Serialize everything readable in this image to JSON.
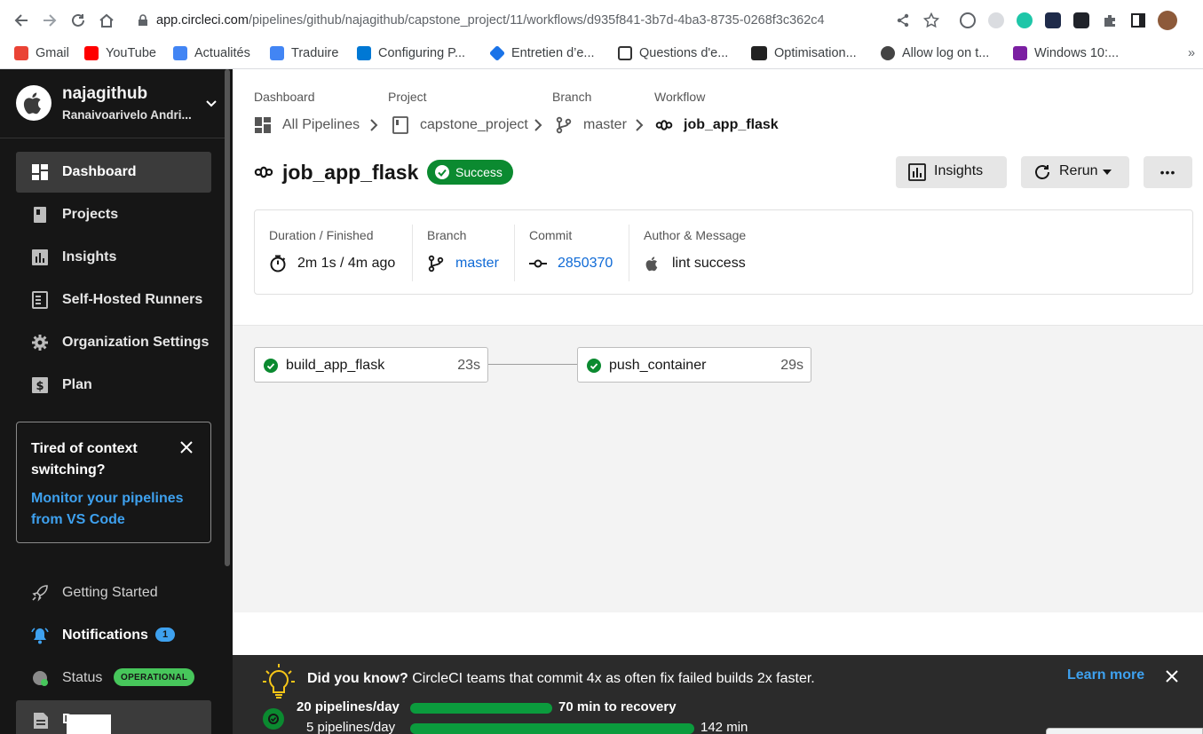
{
  "browser": {
    "url_host": "app.circleci.com",
    "url_path": "/pipelines/github/najagithub/capstone_project/11/workflows/d935f841-3b7d-4ba3-8735-0268f3c362c4",
    "bookmarks": [
      {
        "label": "Gmail",
        "icon": "gmail-icon",
        "color": "#ea4335"
      },
      {
        "label": "YouTube",
        "icon": "youtube-icon",
        "color": "#ff0000"
      },
      {
        "label": "Actualités",
        "icon": "news-icon",
        "color": "#4285f4"
      },
      {
        "label": "Traduire",
        "icon": "translate-icon",
        "color": "#4285f4"
      },
      {
        "label": "Configuring P...",
        "icon": "windows-icon",
        "color": "#0078d4"
      },
      {
        "label": "Entretien d’e...",
        "icon": "diamond-icon",
        "color": "#1a73e8"
      },
      {
        "label": "Questions d'e...",
        "icon": "shield-icon",
        "color": "#333333"
      },
      {
        "label": "Optimisation...",
        "icon": "sql-icon",
        "color": "#222222"
      },
      {
        "label": "Allow log on t...",
        "icon": "globe-icon",
        "color": "#444444"
      },
      {
        "label": "Windows 10:...",
        "icon": "grok-icon",
        "color": "#7b1fa2"
      }
    ],
    "more_bookmarks": "»"
  },
  "sidebar": {
    "org_name": "najagithub",
    "user_name": "Ranaivoarivelo Andri...",
    "nav": [
      {
        "label": "Dashboard",
        "icon": "dashboard-icon",
        "active": true
      },
      {
        "label": "Projects",
        "icon": "projects-icon",
        "active": false
      },
      {
        "label": "Insights",
        "icon": "insights-icon",
        "active": false
      },
      {
        "label": "Self-Hosted Runners",
        "icon": "runners-icon",
        "active": false
      },
      {
        "label": "Organization Settings",
        "icon": "gear-icon",
        "active": false
      },
      {
        "label": "Plan",
        "icon": "dollar-icon",
        "active": false
      }
    ],
    "promo": {
      "title": "Tired of context switching?",
      "link": "Monitor your pipelines from VS Code"
    },
    "getting_started": "Getting Started",
    "notifications": "Notifications",
    "notifications_count": "1",
    "status": "Status",
    "status_badge": "OPERATIONAL",
    "bottom_partial": "D"
  },
  "breadcrumb": {
    "headings": [
      "Dashboard",
      "Project",
      "Branch",
      "Workflow"
    ],
    "items": [
      "All Pipelines",
      "capstone_project",
      "master",
      "job_app_flask"
    ]
  },
  "workflow": {
    "title": "job_app_flask",
    "status": "Success",
    "actions": {
      "insights": "Insights",
      "rerun": "Rerun",
      "more": "•••"
    },
    "meta": {
      "duration_label": "Duration / Finished",
      "duration_value": "2m 1s / 4m ago",
      "branch_label": "Branch",
      "branch_value": "master",
      "commit_label": "Commit",
      "commit_value": "2850370",
      "author_label": "Author & Message",
      "author_value": "lint success"
    },
    "jobs": [
      {
        "name": "build_app_flask",
        "duration": "23s",
        "status": "success"
      },
      {
        "name": "push_container",
        "duration": "29s",
        "status": "success"
      }
    ]
  },
  "did_you_know": {
    "heading": "Did you know?",
    "text": "CircleCI teams that commit 4x as often fix failed builds 2x faster.",
    "learn_more": "Learn more",
    "rows": [
      {
        "left": "20 pipelines/day",
        "right": "70 min to recovery",
        "fill": 0.35
      },
      {
        "left": "5 pipelines/day",
        "right": "142 min",
        "fill": 0.7
      }
    ]
  },
  "colors": {
    "sidebar_bg": "#161616",
    "success": "#0b8a30",
    "link": "#0f6ad6",
    "accent_blue": "#3ea1ef",
    "operational": "#47c65b"
  }
}
